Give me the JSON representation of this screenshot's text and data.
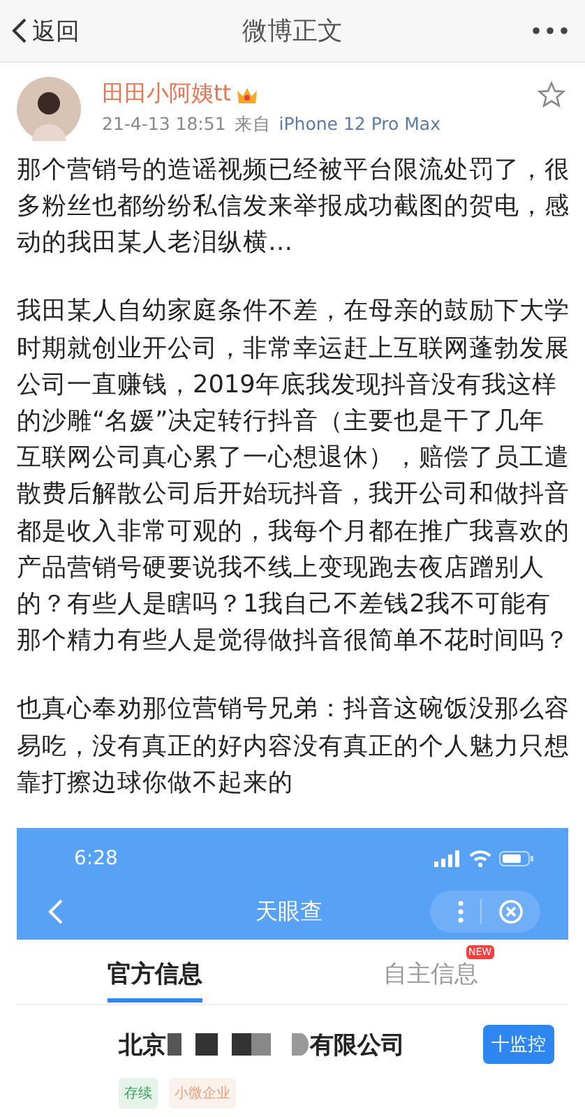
{
  "nav": {
    "back": "返回",
    "title": "微博正文"
  },
  "post": {
    "author": "田田小阿姨tt",
    "time": "21-4-13 18:51",
    "source_prefix": "来自",
    "source": "iPhone 12 Pro Max",
    "starred": false,
    "paragraphs": [
      "那个营销号的造谣视频已经被平台限流处罚了，很多粉丝也都纷纷私信发来举报成功截图的贺电，感动的我田某人老泪纵横…",
      "我田某人自幼家庭条件不差，在母亲的鼓励下大学时期就创业开公司，非常幸运赶上互联网蓬勃发展公司一直赚钱，2019年底我发现抖音没有我这样的沙雕“名媛”决定转行抖音（主要也是干了几年互联网公司真心累了一心想退休），赔偿了员工遣散费后解散公司后开始玩抖音，我开公司和做抖音都是收入非常可观的，我每个月都在推广我喜欢的产品营销号硬要说我不线上变现跑去夜店蹭别人的？有些人是瞎吗？1我自己不差钱2我不可能有那个精力有些人是觉得做抖音很简单不花时间吗？",
      "也真心奉劝那位营销号兄弟：抖音这碗饭没那么容易吃，没有真正的好内容没有真正的个人魅力只想靠打擦边球你做不起来的"
    ]
  },
  "shot": {
    "clock": "6:28",
    "title": "天眼查",
    "tabs": [
      {
        "label": "官方信息",
        "selected": true
      },
      {
        "label": "自主信息",
        "selected": false,
        "badge": "NEW"
      }
    ],
    "company": {
      "prefix": "北京",
      "suffix": "有限公司",
      "button": "十监控",
      "tags": [
        {
          "label": "存续",
          "color": "#3aa35b"
        },
        {
          "label": "小微企业",
          "color": "#e8a07a"
        }
      ]
    }
  }
}
